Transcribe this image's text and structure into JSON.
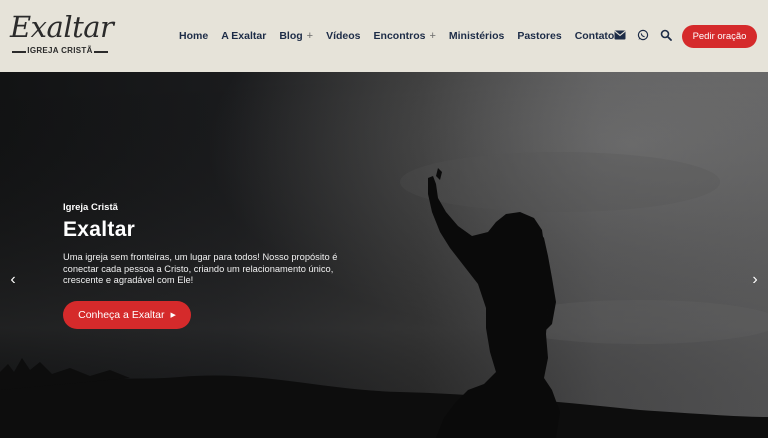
{
  "logo": {
    "script_text": "Exaltar",
    "subtitle": "IGREJA CRISTÃ"
  },
  "nav": {
    "items": [
      {
        "label": "Home"
      },
      {
        "label": "A Exaltar"
      },
      {
        "label": "Blog",
        "plus": "+"
      },
      {
        "label": "Vídeos"
      },
      {
        "label": "Encontros",
        "plus": "+"
      },
      {
        "label": "Ministérios"
      },
      {
        "label": "Pastores"
      },
      {
        "label": "Contatos"
      }
    ]
  },
  "icons": [
    "envelope-icon",
    "whatsapp-icon",
    "search-icon"
  ],
  "header": {
    "cta_label": "Pedir oração",
    "accent": "#d52a2b",
    "nav_color": "#1d2c47",
    "bg": "#e6e3d9"
  },
  "hero": {
    "eyebrow": "Igreja Cristã",
    "title": "Exaltar",
    "text": "Uma igreja sem fronteiras, um lugar para todos! Nosso propósito é conectar cada pessoa a Cristo, criando um relacionamento único, crescente e agradável com Ele!",
    "cta_label": "Conheça a Exaltar",
    "cta_arrow": "▶",
    "arrow_left": "‹",
    "arrow_right": "›"
  }
}
